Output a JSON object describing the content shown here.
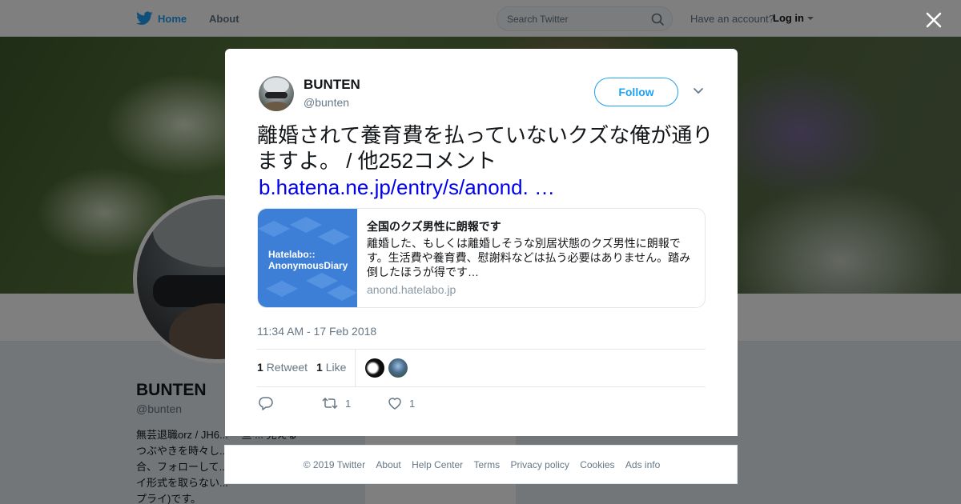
{
  "nav": {
    "home_label": "Home",
    "about_label": "About",
    "search_placeholder": "Search Twitter",
    "have_account": "Have an account?",
    "login_label": "Log in"
  },
  "profile": {
    "name": "BUNTEN",
    "handle": "@bunten",
    "bio": "無芸退職orz / JH6... 一旦 ... 見える\nつぶやきを時々し...\n合、フォローして...\nイ形式を取らない...\nプライ)です。"
  },
  "tweet": {
    "author_name": "BUNTEN",
    "author_handle": "@bunten",
    "follow_label": "Follow",
    "text": "離婚されて養育費を払っていないクズな俺が通りますよ。 / 他252コメント",
    "link_text": "b.hatena.ne.jp/entry/s/anond. …",
    "card": {
      "image_text": "Hatelabo::\nAnonymousDiary",
      "title": "全国のクズ男性に朗報です",
      "description": "離婚した、もしくは離婚しそうな別居状態のクズ男性に朗報です。生活費や養育費、慰謝料などは払う必要はありません。踏み倒したほうが得です…",
      "domain": "anond.hatelabo.jp"
    },
    "timestamp": "11:34 AM - 17 Feb 2018",
    "retweet_count": "1",
    "retweet_label": "Retweet",
    "like_count": "1",
    "like_label": "Like",
    "actions": {
      "retweet_count": "1",
      "like_count": "1"
    }
  },
  "footer": {
    "links": [
      "© 2019 Twitter",
      "About",
      "Help Center",
      "Terms",
      "Privacy policy",
      "Cookies",
      "Ads info"
    ]
  },
  "colors": {
    "brand_blue": "#1da1f2",
    "link_blue": "#0000ee",
    "card_blue": "#3d7fd6",
    "muted": "#657786"
  }
}
